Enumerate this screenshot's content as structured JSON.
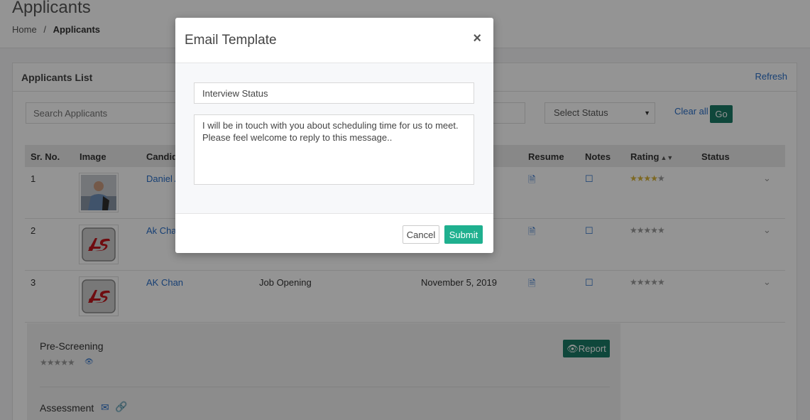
{
  "page": {
    "title": "Applicants"
  },
  "breadcrumb": {
    "home": "Home",
    "separator": "/",
    "current": "Applicants"
  },
  "card": {
    "title": "Applicants List",
    "refresh_label": "Refresh"
  },
  "filters": {
    "search_placeholder": "Search Applicants",
    "status_placeholder": "Select Status",
    "clear_label": "Clear all",
    "go_label": "Go"
  },
  "table": {
    "headers": {
      "sr_no": "Sr. No.",
      "image": "Image",
      "candidate": "Candid",
      "resume": "Resume",
      "notes": "Notes",
      "rating": "Rating",
      "status": "Status"
    },
    "rows": [
      {
        "sr": "1",
        "name": "Daniel A",
        "job": "",
        "date": "",
        "rating": 4,
        "image": "photo"
      },
      {
        "sr": "2",
        "name": "Ak Chan",
        "job": "",
        "date": "",
        "rating": 0,
        "image": "logo"
      },
      {
        "sr": "3",
        "name": "AK Chan",
        "job": "Job Opening",
        "date": "November 5, 2019",
        "rating": 0,
        "image": "logo"
      }
    ]
  },
  "prescreening": {
    "title": "Pre-Screening",
    "report_label": "Report",
    "assessment_label": "Assessment",
    "rating": 0
  },
  "modal": {
    "title": "Email Template",
    "close_symbol": "×",
    "subject_value": "Interview Status",
    "message_value": "I will be in touch with you about scheduling time for us to meet. Please feel welcome to reply to this message..",
    "cancel_label": "Cancel",
    "submit_label": "Submit"
  },
  "colors": {
    "accent_green": "#1fb08f",
    "dark_green": "#1b7a66",
    "link_blue": "#2a6fc9",
    "star_gold": "#d7b33a"
  },
  "icons": {
    "resume": "document-icon",
    "notes": "note-icon",
    "expand": "chevron-down-icon",
    "view": "eye-icon",
    "email": "envelope-icon",
    "link": "link-icon",
    "sort": "sort-icon"
  }
}
